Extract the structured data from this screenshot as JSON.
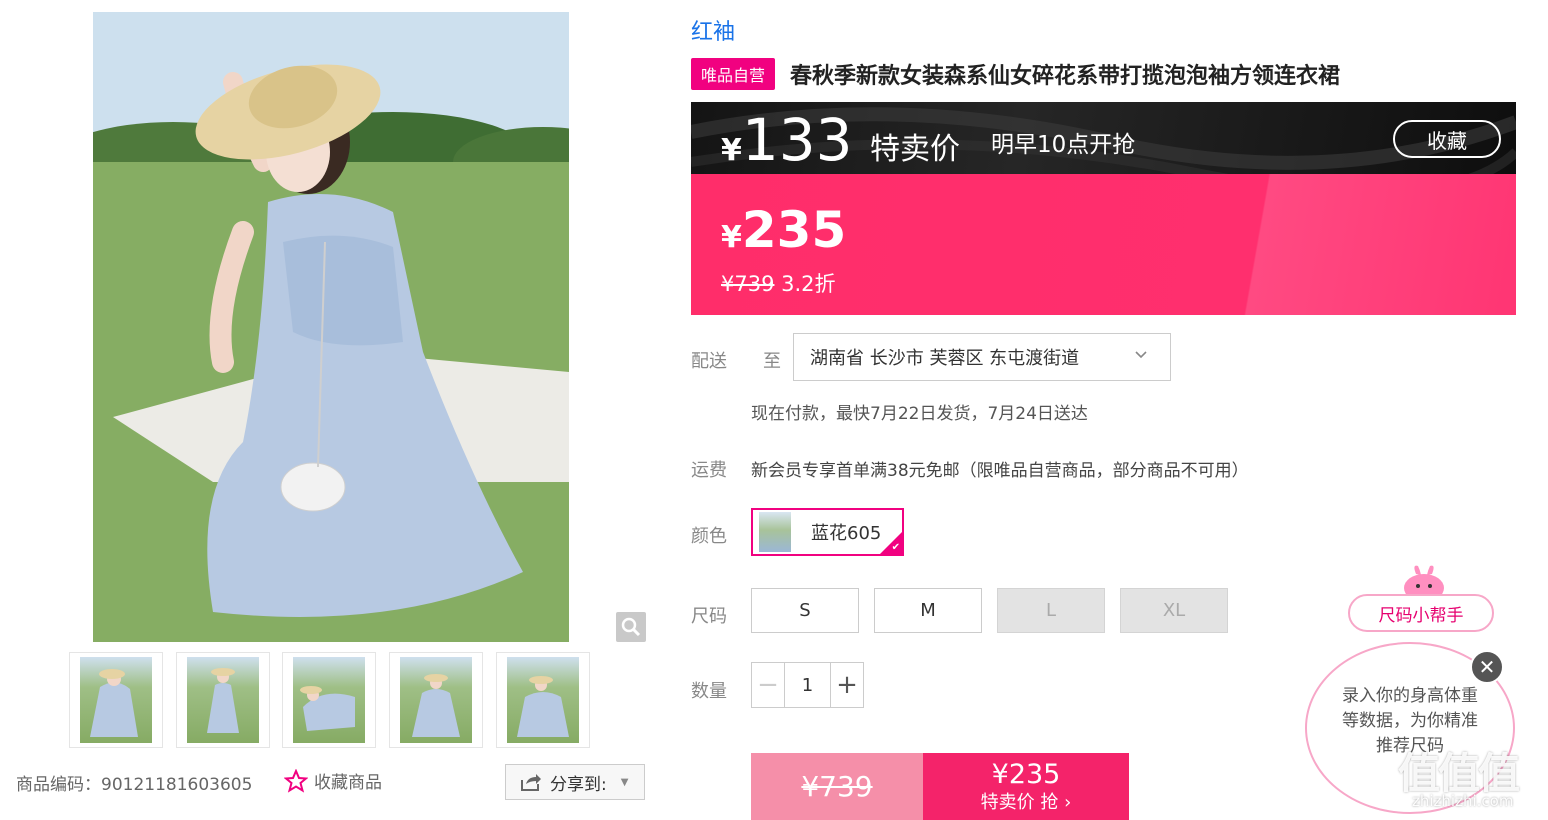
{
  "gallery": {
    "sku_label": "商品编码：90121181603605",
    "favorite_label": "收藏商品",
    "share_label": "分享到:"
  },
  "product": {
    "brand": "红袖",
    "badge": "唯品自营",
    "title": "春秋季新款女装森系仙女碎花系带打揽泡泡袖方领连衣裙"
  },
  "price": {
    "currency": "¥",
    "vip_price": "133",
    "vip_label": "特卖价",
    "vip_note": "明早10点开抢",
    "collect_label": "收藏",
    "current_price": "235",
    "original_price": "¥739",
    "discount": "3.2折"
  },
  "delivery": {
    "label": "配送",
    "to": "至",
    "address": "湖南省 长沙市 芙蓉区 东屯渡街道",
    "note": "现在付款，最快7月22日发货，7月24日送达"
  },
  "freight": {
    "label": "运费",
    "text": "新会员专享首单满38元免邮（限唯品自营商品，部分商品不可用）"
  },
  "color": {
    "label": "颜色",
    "selected": "蓝花605"
  },
  "size": {
    "label": "尺码",
    "options": [
      {
        "label": "S",
        "available": true
      },
      {
        "label": "M",
        "available": true
      },
      {
        "label": "L",
        "available": false
      },
      {
        "label": "XL",
        "available": false
      }
    ]
  },
  "quantity": {
    "label": "数量",
    "value": "1",
    "minus": "−",
    "plus": "+"
  },
  "buy": {
    "original": "¥739",
    "price": "¥235",
    "action": "特卖价 抢 ›"
  },
  "helper": {
    "title": "尺码小帮手",
    "text": "录入你的身高体重等数据，为你精准推荐尺码",
    "close": "✕"
  },
  "watermark": {
    "logo": "值值值",
    "url": "zhizhizhi.com"
  },
  "colors": {
    "accent": "#f10180",
    "price_red": "#ff2d6a",
    "link_blue": "#1a73e8"
  }
}
